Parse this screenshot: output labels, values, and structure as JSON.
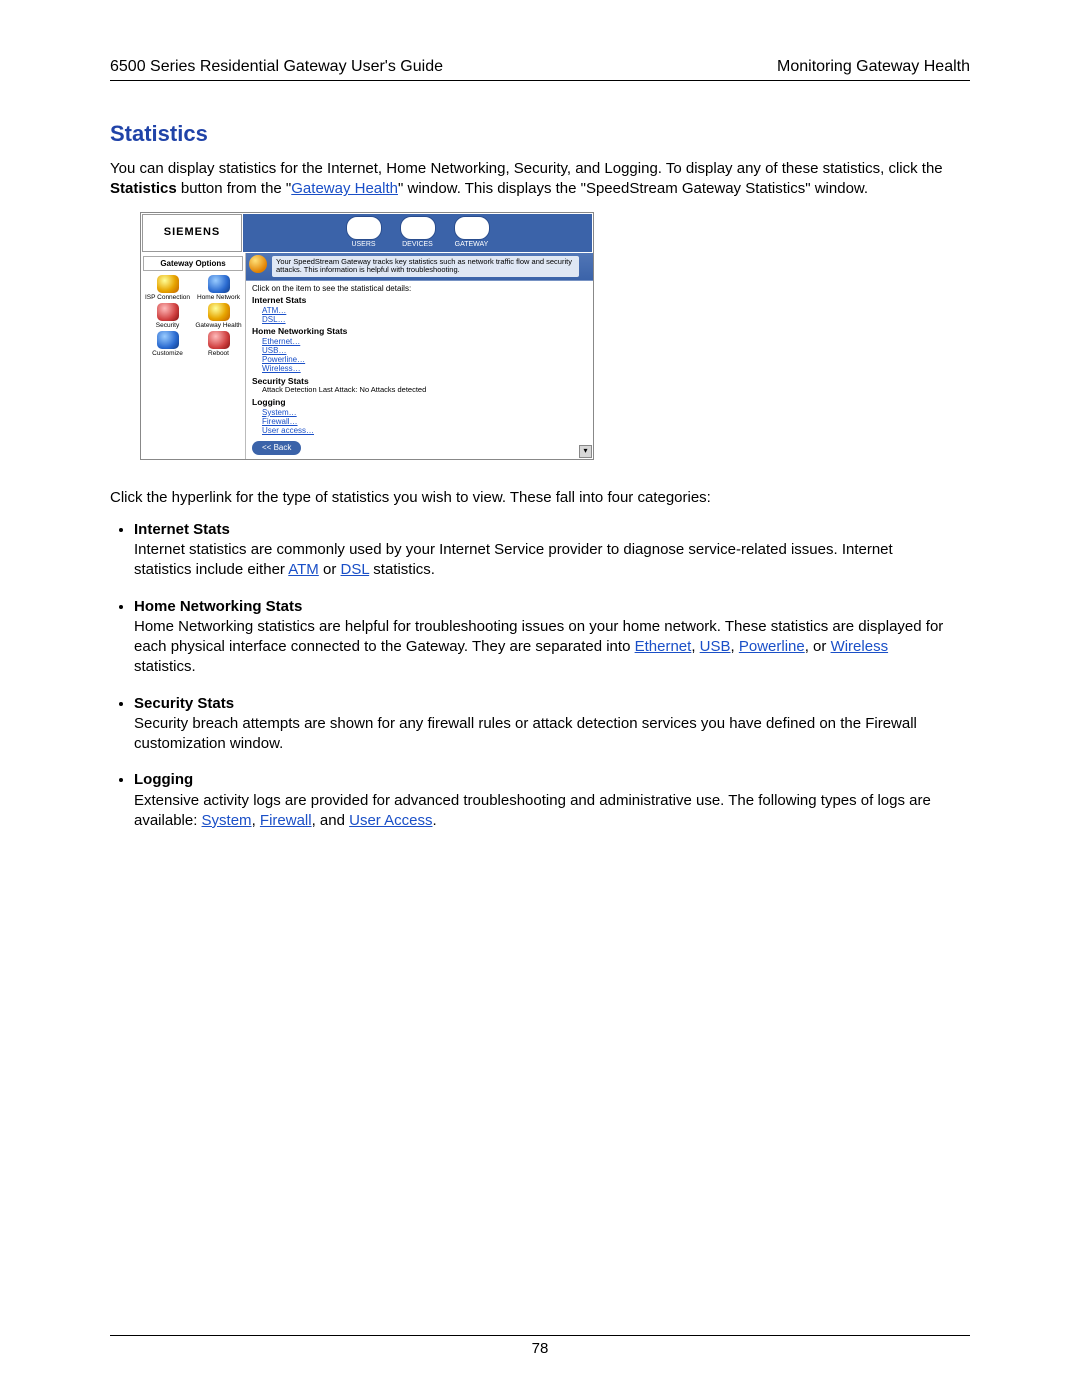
{
  "header": {
    "left": "6500 Series Residential Gateway User's Guide",
    "right": "Monitoring Gateway Health"
  },
  "title": "Statistics",
  "intro": {
    "pre": "You can display statistics for the Internet, Home Networking, Security, and Logging. To display any of these statistics, click the ",
    "bold1": "Statistics",
    "mid1": " button from the \"",
    "link1": "Gateway Health",
    "mid2": "\" window. This displays the \"SpeedStream Gateway Statistics\" window."
  },
  "after_shot": "Click the hyperlink for the type of statistics you wish to view. These fall into four categories:",
  "cats": [
    {
      "title": "Internet Stats",
      "parts": [
        {
          "t": "text",
          "v": "Internet statistics are commonly used by your Internet Service provider to diagnose service-related issues. Internet statistics include either "
        },
        {
          "t": "link",
          "v": "ATM"
        },
        {
          "t": "text",
          "v": " or "
        },
        {
          "t": "link",
          "v": "DSL"
        },
        {
          "t": "text",
          "v": " statistics."
        }
      ]
    },
    {
      "title": "Home Networking Stats",
      "parts": [
        {
          "t": "text",
          "v": "Home Networking statistics are helpful for troubleshooting issues on your home network. These statistics are displayed for each physical interface connected to the Gateway. They are separated into "
        },
        {
          "t": "link",
          "v": "Ethernet"
        },
        {
          "t": "text",
          "v": ", "
        },
        {
          "t": "link",
          "v": "USB"
        },
        {
          "t": "text",
          "v": ", "
        },
        {
          "t": "link",
          "v": "Powerline"
        },
        {
          "t": "text",
          "v": ", or "
        },
        {
          "t": "link",
          "v": "Wireless"
        },
        {
          "t": "text",
          "v": " statistics."
        }
      ]
    },
    {
      "title": "Security Stats",
      "parts": [
        {
          "t": "text",
          "v": "Security breach attempts are shown for any firewall rules or attack detection services you have defined on the Firewall customization window."
        }
      ]
    },
    {
      "title": "Logging",
      "parts": [
        {
          "t": "text",
          "v": "Extensive activity logs are provided for advanced troubleshooting and administrative use. The following types of logs are available: "
        },
        {
          "t": "link",
          "v": "System"
        },
        {
          "t": "text",
          "v": ", "
        },
        {
          "t": "link",
          "v": "Firewall"
        },
        {
          "t": "text",
          "v": ", and "
        },
        {
          "t": "link",
          "v": "User Access"
        },
        {
          "t": "text",
          "v": "."
        }
      ]
    }
  ],
  "page_number": "78",
  "screenshot": {
    "logo": "SIEMENS",
    "topnav": [
      "USERS",
      "DEVICES",
      "GATEWAY"
    ],
    "side_title": "Gateway Options",
    "side_items": [
      {
        "label": "ISP Connection",
        "c": ""
      },
      {
        "label": "Home Network",
        "c": "blue"
      },
      {
        "label": "Security",
        "c": "red"
      },
      {
        "label": "Gateway Health",
        "c": ""
      },
      {
        "label": "Customize",
        "c": "blue"
      },
      {
        "label": "Reboot",
        "c": "red"
      }
    ],
    "banner": "Your SpeedStream Gateway tracks key statistics such as network traffic flow and security attacks. This information is helpful with troubleshooting.",
    "subhead": "Click on the item to see the statistical details:",
    "groups": [
      {
        "h": "Internet Stats",
        "links": [
          "ATM…",
          "DSL…"
        ]
      },
      {
        "h": "Home Networking Stats",
        "links": [
          "Ethernet…",
          "USB…",
          "Powerline…",
          "Wireless…"
        ]
      },
      {
        "h": "Security Stats",
        "note": "Attack Detection Last Attack: No Attacks detected"
      },
      {
        "h": "Logging",
        "links": [
          "System…",
          "Firewall…",
          "User access…"
        ]
      }
    ],
    "back": "<< Back"
  }
}
